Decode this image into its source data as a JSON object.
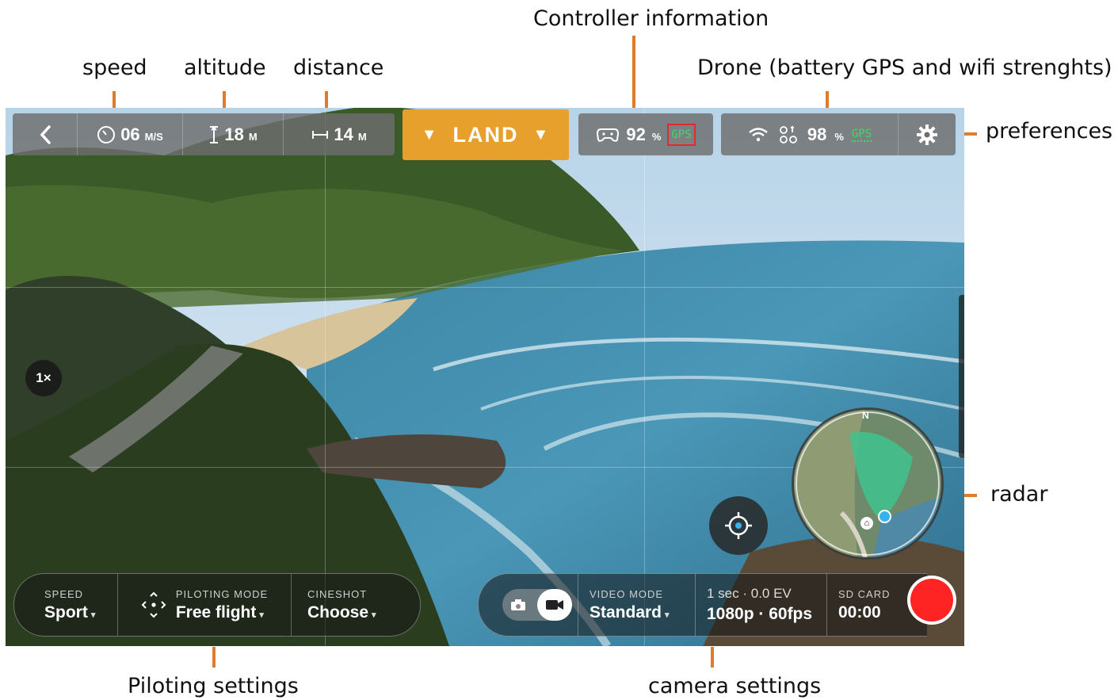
{
  "annotations": {
    "speed": "speed",
    "altitude": "altitude",
    "distance": "distance",
    "controller": "Controller information",
    "drone": "Drone (battery GPS and wifi strenghts)",
    "preferences": "preferences",
    "radar": "radar",
    "piloting": "Piloting settings",
    "camera": "camera settings"
  },
  "top_bar": {
    "back_icon": "chevron-left-icon",
    "speed": {
      "icon": "speedometer-icon",
      "value": "06",
      "unit": "M/S"
    },
    "altitude": {
      "icon": "altitude-icon",
      "value": "18",
      "unit": "M"
    },
    "distance": {
      "icon": "distance-icon",
      "value": "14",
      "unit": "M"
    },
    "land_label": "LAND",
    "controller": {
      "icon": "gamepad-icon",
      "battery": "92",
      "unit": "%",
      "gps": "GPS",
      "gps_color": "#3ddc5a"
    },
    "drone": {
      "wifi_icon": "wifi-icon",
      "drone_icon": "drone-icon",
      "battery": "98",
      "unit": "%",
      "gps": "GPS",
      "gps_color": "#3ddc5a"
    },
    "settings_icon": "gear-icon"
  },
  "overlay": {
    "zoom": "1×",
    "recenter_icon": "crosshair-icon",
    "radar_north": "N"
  },
  "piloting_bar": {
    "speed_label": "SPEED",
    "speed_value": "Sport",
    "mode_label": "PILOTING MODE",
    "mode_value": "Free flight",
    "cineshot_label": "CINESHOT",
    "cineshot_value": "Choose"
  },
  "camera_bar": {
    "photo_icon": "camera-icon",
    "video_icon": "video-icon",
    "video_mode_label": "VIDEO MODE",
    "video_mode_value": "Standard",
    "exposure": "1 sec · 0.0 EV",
    "resolution": "1080p · 60fps",
    "sd_label": "SD CARD",
    "sd_value": "00:00",
    "record_color": "#ff2424"
  },
  "colors": {
    "accent": "#e8a02d",
    "annotation_tick": "#e07b2a"
  }
}
